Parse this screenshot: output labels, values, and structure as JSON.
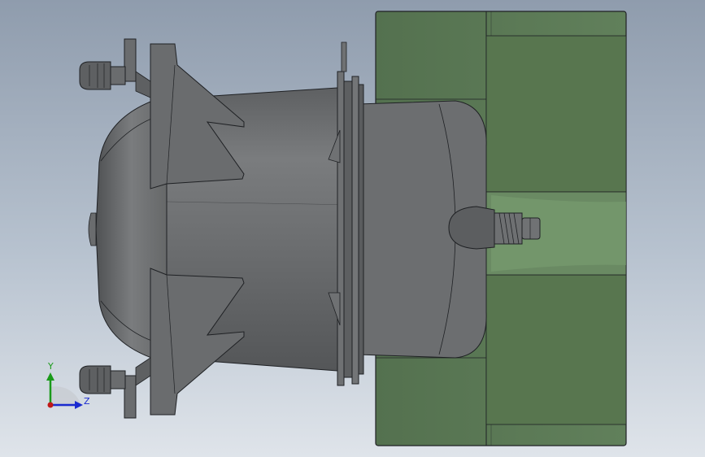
{
  "viewport": {
    "background_top": "#8f9cad",
    "background_bottom": "#dfe4ea"
  },
  "model": {
    "body_color": "#6f7173",
    "body_dark": "#4e5052",
    "edge_color": "#1f2124",
    "bracket_color": "#5d7a58",
    "bracket_dark": "#4c6749"
  },
  "triad": {
    "y_label": "Y",
    "z_label": "Z",
    "y_color": "#1a9a1a",
    "z_color": "#1a2ad0",
    "x_color": "#c01818"
  }
}
